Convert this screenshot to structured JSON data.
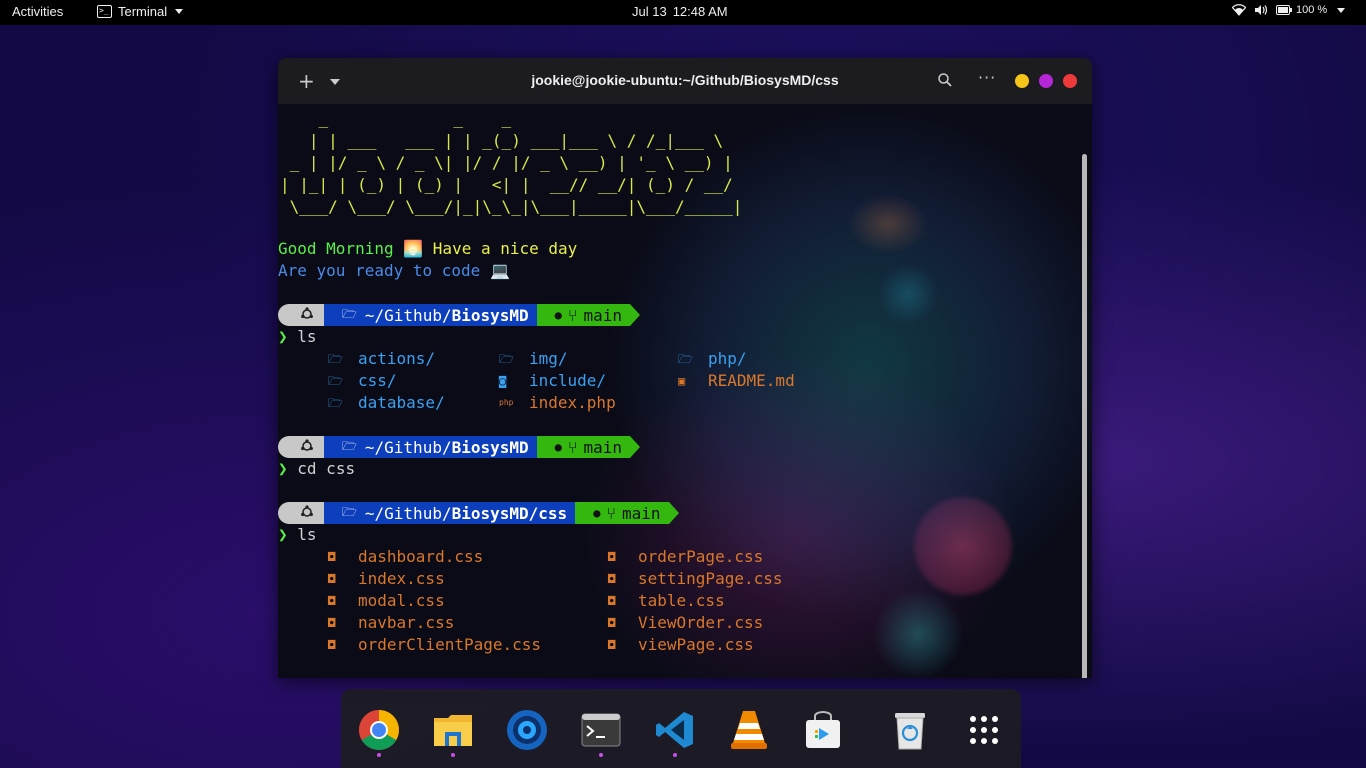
{
  "topbar": {
    "activities": "Activities",
    "app_name": "Terminal",
    "date": "Jul 13",
    "time": "12:48 AM",
    "battery": "100 %"
  },
  "window": {
    "title": "jookie@jookie-ubuntu:~/Github/BiosysMD/css",
    "new_tab_icon": "plus-icon",
    "menu_icon": "chevron-down-icon",
    "search_icon": "search-icon",
    "more_icon": "more-icon",
    "buttons": {
      "minimize": "#f5c518",
      "maximize": "#b426d6",
      "close": "#ee3a3a"
    }
  },
  "terminal": {
    "ascii_art": "    _             _    _                          \n   | | ___   ___ | | _(_) ___|___ \\ / /_|___ \\ \n _ | |/ _ \\ / _ \\| |/ / |/ _ \\ __) | '_ \\ __) |\n| |_| | (_) | (_) |   <| |  __// __/| (_) / __/ \n \\___/ \\___/ \\___/|_|\\_\\_|\\___|_____|\\___/_____|",
    "greeting_a": "Good Morning",
    "greeting_emoji": "🌅",
    "greeting_b": "Have a nice day",
    "question": "Are you ready to code",
    "question_emoji": "💻",
    "prompt_char": "❯",
    "prompts": [
      {
        "path_prefix": "~/Github/",
        "path_bold": "BiosysMD",
        "path_suffix": "",
        "branch": "main",
        "command": "ls"
      },
      {
        "path_prefix": "~/Github/",
        "path_bold": "BiosysMD",
        "path_suffix": "",
        "branch": "main",
        "command": "cd css"
      },
      {
        "path_prefix": "~/Github/",
        "path_bold": "BiosysMD/css",
        "path_suffix": "",
        "branch": "main",
        "command": "ls"
      }
    ],
    "listing1": [
      {
        "name": "actions/",
        "type": "dir"
      },
      {
        "name": "css/",
        "type": "dir"
      },
      {
        "name": "database/",
        "type": "dir"
      },
      {
        "name": "img/",
        "type": "dir"
      },
      {
        "name": "include/",
        "type": "dir-special"
      },
      {
        "name": "index.php",
        "type": "php"
      },
      {
        "name": "php/",
        "type": "dir"
      },
      {
        "name": "README.md",
        "type": "md"
      }
    ],
    "listing2": [
      "dashboard.css",
      "index.css",
      "modal.css",
      "navbar.css",
      "orderClientPage.css",
      "orderPage.css",
      "settingPage.css",
      "table.css",
      "ViewOrder.css",
      "viewPage.css"
    ],
    "icons": {
      "dir": "folder-icon",
      "php": "php-icon",
      "md": "markdown-icon",
      "css": "css3-icon",
      "os": "ubuntu-icon",
      "git": "github-icon",
      "branch": "git-branch-icon"
    },
    "colors": {
      "path_bg": "#0d3fbd",
      "git_bg": "#34b80f",
      "os_bg": "#c8c8c8",
      "dir": "#3aa0f0",
      "file": "#d9782b"
    }
  },
  "dock": {
    "apps": [
      "chrome-icon",
      "file-manager-icon",
      "app-icon",
      "terminal-icon",
      "vscode-icon",
      "vlc-icon",
      "software-store-icon",
      "trash-icon",
      "app-grid-icon"
    ]
  }
}
